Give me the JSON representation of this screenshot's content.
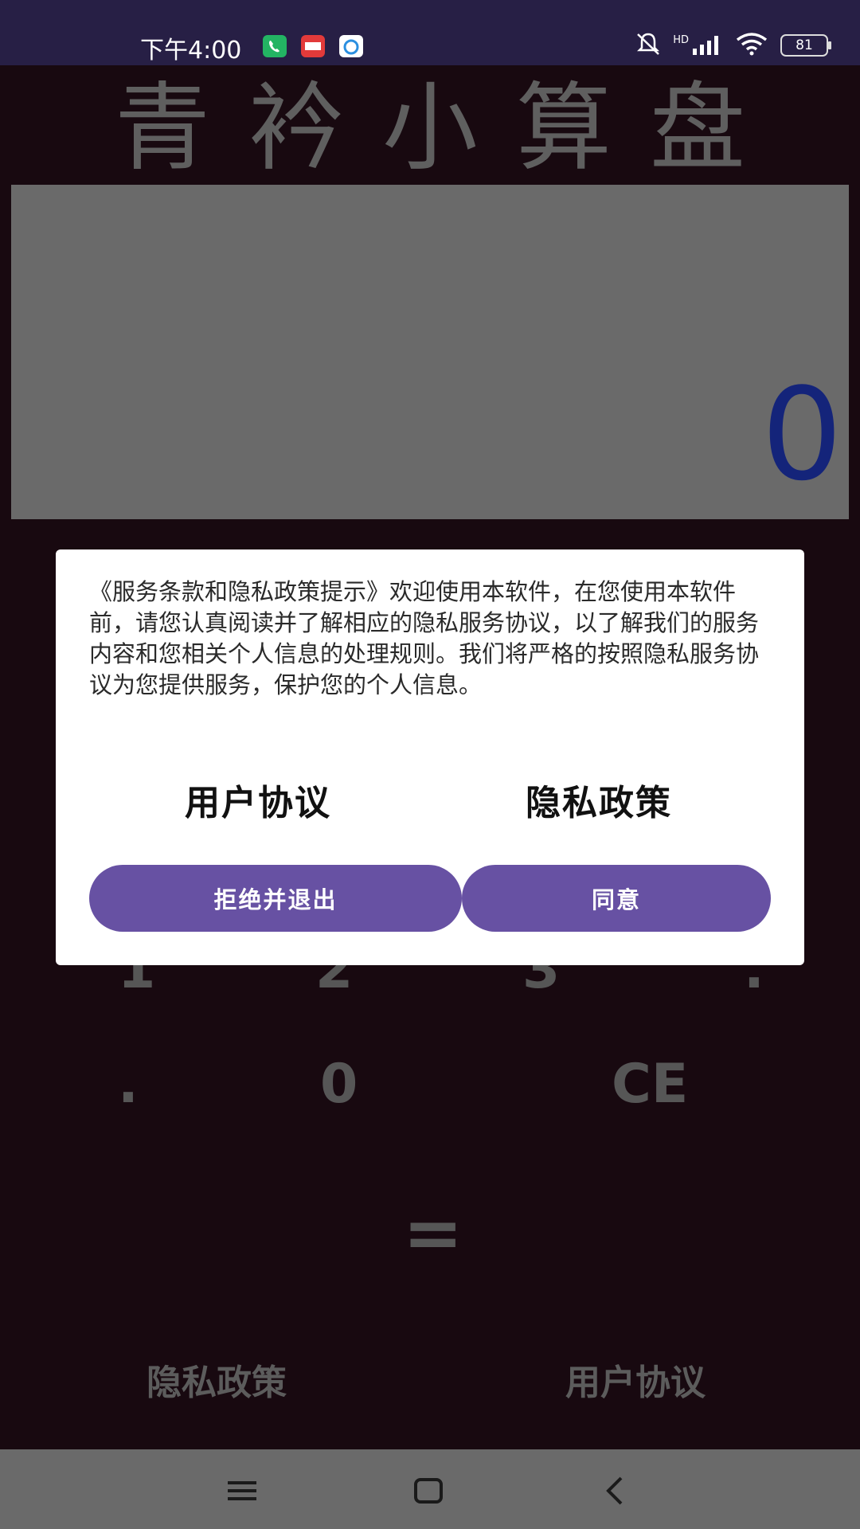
{
  "status_bar": {
    "time": "下午4:00",
    "signal": "HD",
    "battery": "81",
    "icons": [
      "phone-app-icon",
      "kandian-app-icon",
      "browser-app-icon",
      "bell-muted-icon",
      "signal-icon",
      "wifi-icon",
      "battery-icon"
    ]
  },
  "app": {
    "title": "青衿小算盘",
    "display_value": "0",
    "keys": {
      "row_partial": [
        "1",
        "2",
        "3",
        "."
      ],
      "row_last": [
        ".",
        "0",
        "CE"
      ],
      "equals": "="
    },
    "bottom_links": {
      "privacy": "隐私政策",
      "agreement": "用户协议"
    }
  },
  "dialog": {
    "body": "《服务条款和隐私政策提示》欢迎使用本软件，在您使用本软件前，请您认真阅读并了解相应的隐私服务协议，以了解我们的服务内容和您相关个人信息的处理规则。我们将严格的按照隐私服务协议为您提供服务，保护您的个人信息。",
    "user_agreement_link": "用户协议",
    "privacy_policy_link": "隐私政策",
    "reject_button": "拒绝并退出",
    "agree_button": "同意"
  },
  "colors": {
    "status_bar_bg": "#271f45",
    "app_bg": "#180910",
    "display_bg": "#6a6a6a",
    "display_text": "#14247a",
    "button_accent": "#6751a3"
  },
  "nav_bar": {
    "icons": [
      "menu-icon",
      "home-icon",
      "back-icon"
    ]
  }
}
